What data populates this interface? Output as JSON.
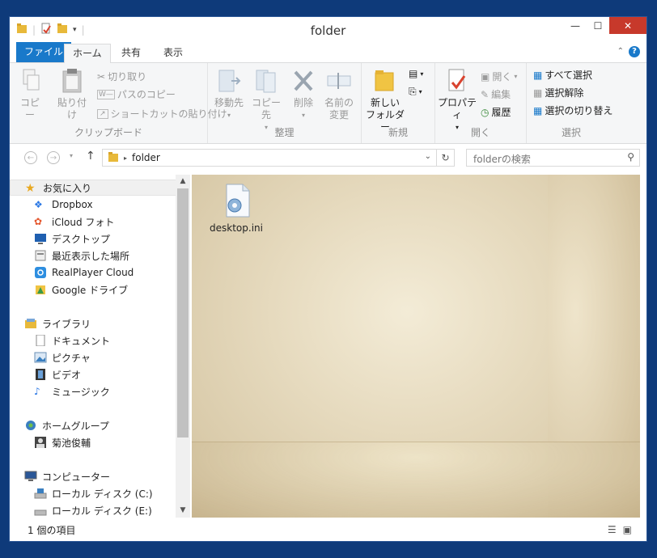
{
  "window": {
    "title": "folder"
  },
  "ribbon_tabs": {
    "file": "ファイル",
    "home": "ホーム",
    "share": "共有",
    "view": "表示"
  },
  "clipboard": {
    "copy": "コピー",
    "paste": "貼り付け",
    "cut": "切り取り",
    "copy_path": "パスのコピー",
    "paste_shortcut": "ショートカットの貼り付け",
    "label": "クリップボード"
  },
  "organize": {
    "move_to": "移動先",
    "copy_to": "コピー先",
    "delete": "削除",
    "rename_line1": "名前の",
    "rename_line2": "変更",
    "label": "整理"
  },
  "new": {
    "new_folder_line1": "新しい",
    "new_folder_line2": "フォルダー",
    "label": "新規"
  },
  "open": {
    "properties": "プロパティ",
    "open": "開く",
    "edit": "編集",
    "history": "履歴",
    "label": "開く"
  },
  "select": {
    "select_all": "すべて選択",
    "select_none": "選択解除",
    "invert": "選択の切り替え",
    "label": "選択"
  },
  "address": {
    "crumb": "folder",
    "search_placeholder": "folderの検索"
  },
  "nav": {
    "favorites": "お気に入り",
    "dropbox": "Dropbox",
    "icloud": "iCloud フォト",
    "desktop": "デスクトップ",
    "recent": "最近表示した場所",
    "realplayer": "RealPlayer Cloud",
    "gdrive": "Google ドライブ",
    "libraries": "ライブラリ",
    "documents": "ドキュメント",
    "pictures": "ピクチャ",
    "videos": "ビデオ",
    "music": "ミュージック",
    "homegroup": "ホームグループ",
    "user": "菊池俊輔",
    "computer": "コンピューター",
    "disk_c": "ローカル ディスク (C:)",
    "disk_e": "ローカル ディスク (E:)"
  },
  "files": [
    {
      "name": "desktop.ini"
    }
  ],
  "status": {
    "count": "1 個の項目"
  },
  "colors": {
    "accent": "#1979ca",
    "frame": "#0e3a7a",
    "close": "#c7392b"
  }
}
